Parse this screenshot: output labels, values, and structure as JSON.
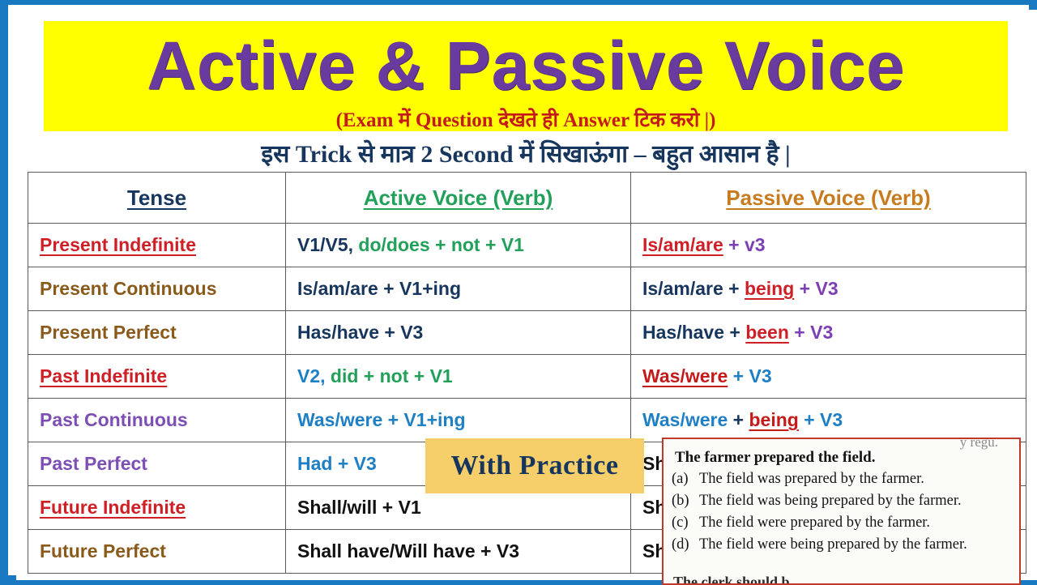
{
  "header": {
    "title": "Active & Passive Voice",
    "subtitle": "(Exam में Question देखते ही Answer टिक करो |)",
    "hindi_line": "इस Trick से मात्र 2 Second में सिखाऊंगा – बहुत आसान है |",
    "band_color": "#ffff00",
    "title_color": "#6a3b9e",
    "subtitle_color": "#c41a1a",
    "hindi_color": "#17365d",
    "frame_color": "#1878c0"
  },
  "table": {
    "columns": [
      {
        "label": "Tense",
        "color": "#17365d"
      },
      {
        "label": "Active Voice (Verb)",
        "color": "#22a05a"
      },
      {
        "label": "Passive Voice (Verb)",
        "color": "#c77a1e"
      }
    ],
    "rows": [
      {
        "tense": "Present Indefinite",
        "active_parts": [
          {
            "text": "V1/V5,",
            "color": "navy"
          },
          {
            "text": " do/does + not + V1",
            "color": "green"
          }
        ],
        "passive_parts": [
          {
            "text": "Is/am/are",
            "color": "red",
            "underline": true
          },
          {
            "text": " + v3",
            "color": "violet"
          }
        ]
      },
      {
        "tense": "Present Continuous",
        "active_parts": [
          {
            "text": "Is/am/are + V1+ing",
            "color": "navy"
          }
        ],
        "passive_parts": [
          {
            "text": "Is/am/are + ",
            "color": "navy"
          },
          {
            "text": "being",
            "color": "red",
            "underline": true
          },
          {
            "text": " + V3",
            "color": "violet"
          }
        ]
      },
      {
        "tense": "Present Perfect",
        "active_parts": [
          {
            "text": "Has/have + V3",
            "color": "navy"
          }
        ],
        "passive_parts": [
          {
            "text": "Has/have + ",
            "color": "navy"
          },
          {
            "text": "been",
            "color": "red",
            "underline": true
          },
          {
            "text": " + V3",
            "color": "violet"
          }
        ]
      },
      {
        "tense": "Past Indefinite",
        "active_parts": [
          {
            "text": "V2,",
            "color": "blue"
          },
          {
            "text": "  did + not + V1",
            "color": "green"
          }
        ],
        "passive_parts": [
          {
            "text": "Was/were",
            "color": "dred",
            "underline": true
          },
          {
            "text": " + V3",
            "color": "blue"
          }
        ]
      },
      {
        "tense": "Past Continuous",
        "active_parts": [
          {
            "text": "Was/were + V1+ing",
            "color": "blue"
          }
        ],
        "passive_parts": [
          {
            "text": "Was/were",
            "color": "blue"
          },
          {
            "text": " + ",
            "color": "navy"
          },
          {
            "text": "being",
            "color": "dred",
            "underline": true
          },
          {
            "text": " + V3",
            "color": "blue"
          }
        ]
      },
      {
        "tense": "Past Perfect",
        "active_parts": [
          {
            "text": "Had + V3",
            "color": "blue"
          }
        ],
        "passive_parts": [
          {
            "text": "Sh",
            "color": "black"
          }
        ]
      },
      {
        "tense": "Future Indefinite",
        "active_parts": [
          {
            "text": "Shall/will + V1",
            "color": "black"
          }
        ],
        "passive_parts": [
          {
            "text": "Sh",
            "color": "black"
          }
        ]
      },
      {
        "tense": "Future Perfect",
        "active_parts": [
          {
            "text": "Shall have/Will have + V3",
            "color": "black"
          }
        ],
        "passive_parts": [
          {
            "text": "Sh",
            "color": "black"
          }
        ]
      }
    ],
    "tense_styles": [
      "t-red u",
      "t-brown",
      "t-brown",
      "t-red u",
      "t-purple",
      "t-purple",
      "t-red u",
      "t-brown"
    ]
  },
  "overlays": {
    "practice_badge": {
      "label": "With Practice",
      "bg": "#f7cf6a",
      "color": "#17365d"
    },
    "question_box": {
      "border_color": "#c0392b",
      "stem": "The farmer prepared the field.",
      "options": [
        {
          "label": "(a)",
          "text": "The field was prepared by the farmer."
        },
        {
          "label": "(b)",
          "text": "The field was being prepared by the farmer."
        },
        {
          "label": "(c)",
          "text": "The field were prepared by the farmer."
        },
        {
          "label": "(d)",
          "text": "The field were being prepared by the farmer."
        }
      ]
    }
  }
}
